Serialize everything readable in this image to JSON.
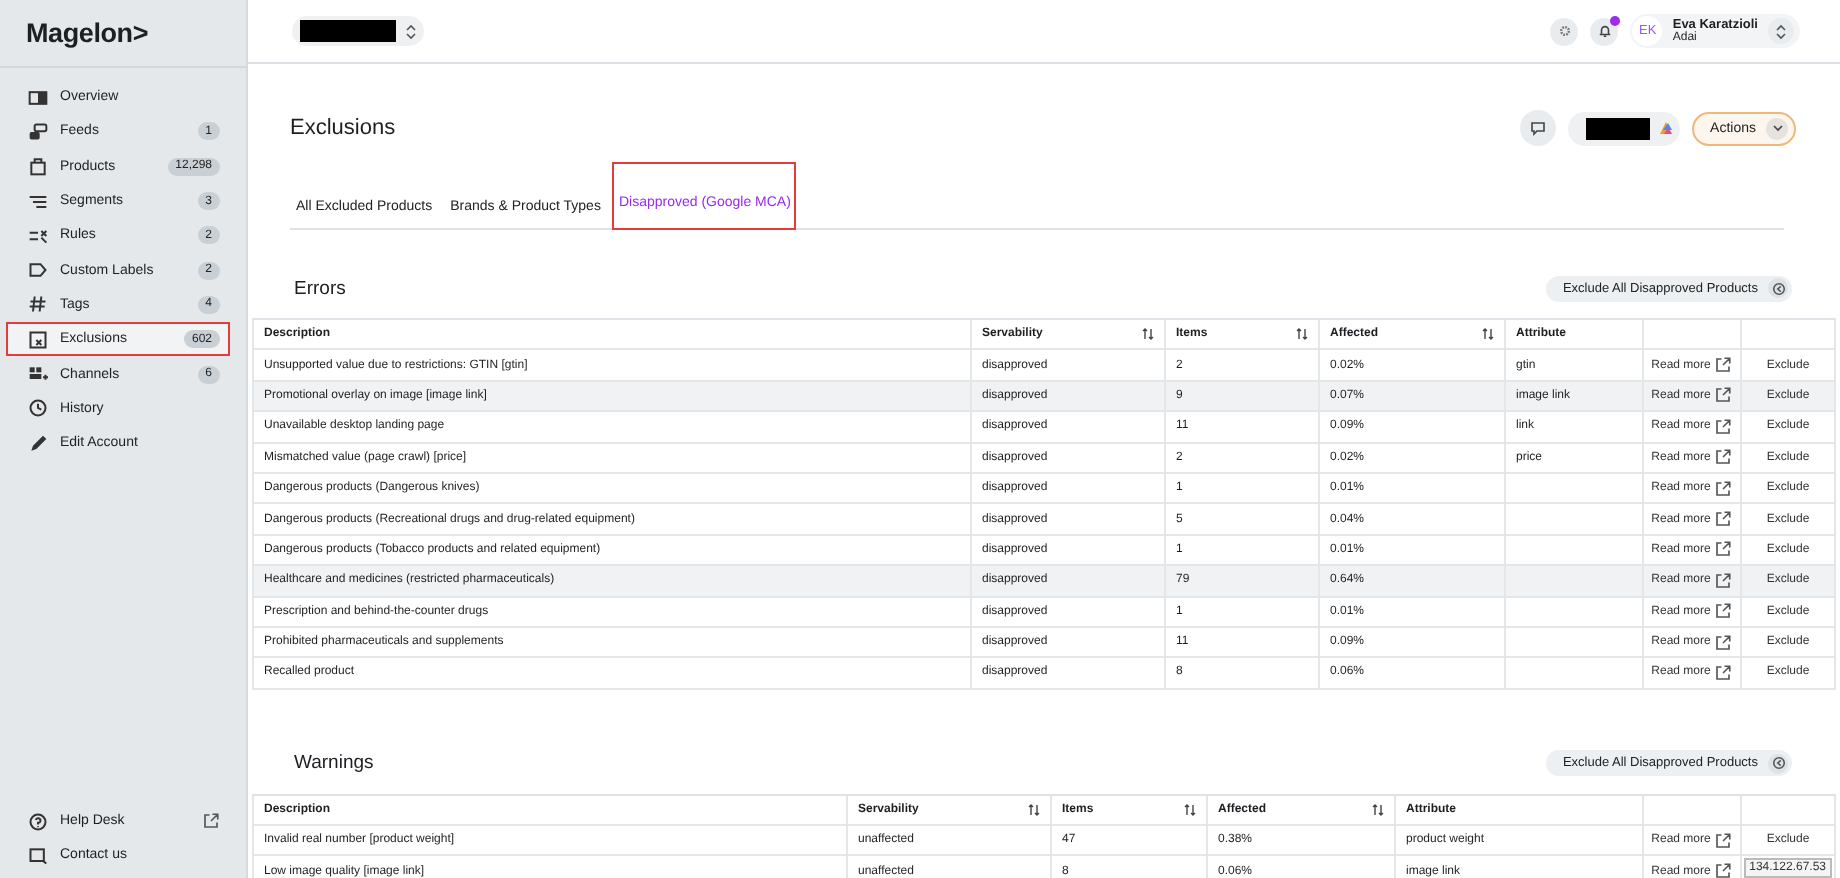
{
  "sidebar": {
    "logo": "Magelon>",
    "items": [
      {
        "label": "Overview",
        "selected": false,
        "highlighted": false
      },
      {
        "label": "Feeds",
        "count": "1",
        "selected": false,
        "highlighted": false
      },
      {
        "label": "Products",
        "count": "12,298",
        "selected": false,
        "highlighted": false
      },
      {
        "label": "Segments",
        "count": "3",
        "selected": false,
        "highlighted": false
      },
      {
        "label": "Rules",
        "count": "2",
        "selected": false,
        "highlighted": false
      },
      {
        "label": "Custom Labels",
        "count": "2",
        "selected": false,
        "highlighted": false
      },
      {
        "label": "Tags",
        "count": "4",
        "selected": false,
        "highlighted": false
      },
      {
        "label": "Exclusions",
        "count": "602",
        "selected": true,
        "highlighted": true
      },
      {
        "label": "Channels",
        "count": "6",
        "selected": false,
        "highlighted": false
      },
      {
        "label": "History",
        "selected": false,
        "highlighted": false
      },
      {
        "label": "Edit Account",
        "selected": false,
        "highlighted": false
      }
    ],
    "footer": [
      {
        "label": "Help Desk",
        "external": true
      },
      {
        "label": "Contact us",
        "external": false
      }
    ]
  },
  "topbar": {
    "user": {
      "initials": "EK",
      "name": "Eva Karatzioli",
      "account": "Adai"
    },
    "notification": true
  },
  "header": {
    "title": "Exclusions",
    "actions": "Actions"
  },
  "tabs": [
    {
      "label": "All Excluded Products",
      "selected": false,
      "highlighted": false
    },
    {
      "label": "Brands & Product Types",
      "selected": false,
      "highlighted": false
    },
    {
      "label": "Disapproved (Google MCA)",
      "selected": true,
      "highlighted": true
    }
  ],
  "sections": [
    {
      "title": "Errors",
      "action": "Exclude All Disapproved Products",
      "columns": [
        {
          "label": "Description",
          "sortable": false
        },
        {
          "label": "Servability",
          "sortable": true
        },
        {
          "label": "Items",
          "sortable": true
        },
        {
          "label": "Affected",
          "sortable": true
        },
        {
          "label": "Attribute",
          "sortable": false
        }
      ],
      "rows": [
        {
          "description": "Unsupported value due to restrictions: GTIN [gtin]",
          "servability": "disapproved",
          "items": "2",
          "affected": "0.02%",
          "attribute": "gtin",
          "link": "Read more",
          "action": "Exclude",
          "shaded": false
        },
        {
          "description": "Promotional overlay on image [image link]",
          "servability": "disapproved",
          "items": "9",
          "affected": "0.07%",
          "attribute": "image link",
          "link": "Read more",
          "action": "Exclude",
          "shaded": true
        },
        {
          "description": "Unavailable desktop landing page",
          "servability": "disapproved",
          "items": "11",
          "affected": "0.09%",
          "attribute": "link",
          "link": "Read more",
          "action": "Exclude",
          "shaded": false
        },
        {
          "description": "Mismatched value (page crawl) [price]",
          "servability": "disapproved",
          "items": "2",
          "affected": "0.02%",
          "attribute": "price",
          "link": "Read more",
          "action": "Exclude",
          "shaded": false
        },
        {
          "description": "Dangerous products (Dangerous knives)",
          "servability": "disapproved",
          "items": "1",
          "affected": "0.01%",
          "link": "Read more",
          "action": "Exclude",
          "shaded": false
        },
        {
          "description": "Dangerous products (Recreational drugs and drug-related equipment)",
          "servability": "disapproved",
          "items": "5",
          "affected": "0.04%",
          "link": "Read more",
          "action": "Exclude",
          "shaded": false
        },
        {
          "description": "Dangerous products (Tobacco products and related equipment)",
          "servability": "disapproved",
          "items": "1",
          "affected": "0.01%",
          "link": "Read more",
          "action": "Exclude",
          "shaded": false
        },
        {
          "description": "Healthcare and medicines (restricted pharmaceuticals)",
          "servability": "disapproved",
          "items": "79",
          "affected": "0.64%",
          "link": "Read more",
          "action": "Exclude",
          "shaded": true
        },
        {
          "description": "Prescription and behind-the-counter drugs",
          "servability": "disapproved",
          "items": "1",
          "affected": "0.01%",
          "link": "Read more",
          "action": "Exclude",
          "shaded": false
        },
        {
          "description": "Prohibited pharmaceuticals and supplements",
          "servability": "disapproved",
          "items": "11",
          "affected": "0.09%",
          "link": "Read more",
          "action": "Exclude",
          "shaded": false
        },
        {
          "description": "Recalled product",
          "servability": "disapproved",
          "items": "8",
          "affected": "0.06%",
          "link": "Read more",
          "action": "Exclude",
          "shaded": false
        }
      ]
    },
    {
      "title": "Warnings",
      "action": "Exclude All Disapproved Products",
      "columns": [
        {
          "label": "Description",
          "sortable": false
        },
        {
          "label": "Servability",
          "sortable": true
        },
        {
          "label": "Items",
          "sortable": true
        },
        {
          "label": "Affected",
          "sortable": true
        },
        {
          "label": "Attribute",
          "sortable": false
        }
      ],
      "rows": [
        {
          "description": "Invalid real number [product weight]",
          "servability": "unaffected",
          "items": "47",
          "affected": "0.38%",
          "attribute": "product weight",
          "link": "Read more",
          "action": "Exclude",
          "shaded": false
        },
        {
          "description": "Low image quality [image link]",
          "servability": "unaffected",
          "items": "8",
          "affected": "0.06%",
          "attribute": "image link",
          "link": "Read more",
          "shaded": false
        }
      ]
    }
  ],
  "ip_badge": "134.122.67.53"
}
